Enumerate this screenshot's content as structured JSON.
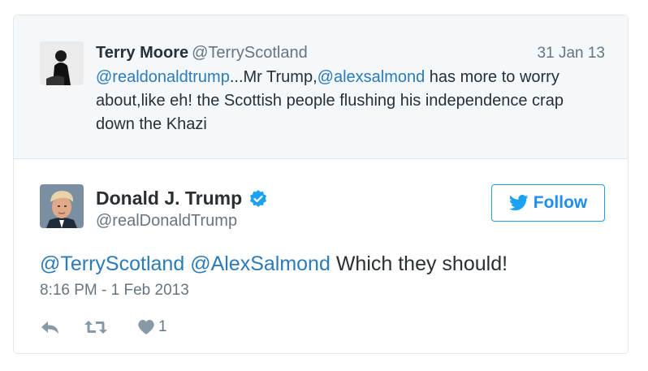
{
  "reply": {
    "name": "Terry Moore",
    "handle": "@TerryScotland",
    "date": "31 Jan 13",
    "mention1": "@realdonaldtrump",
    "text1": "...Mr Trump,",
    "mention2": "@alexsalmond",
    "text2": " has more to worry about,like eh! the Scottish people flushing his independence crap down the Khazi"
  },
  "tweet": {
    "name": "Donald J. Trump",
    "handle": "@realDonaldTrump",
    "mention1": "@TerryScotland",
    "mention2": "@AlexSalmond",
    "text": " Which they should!",
    "timestamp": "8:16 PM - 1 Feb 2013",
    "like_count": "1"
  },
  "follow_button": {
    "label": "Follow"
  },
  "colors": {
    "link": "#2b7bb9",
    "accent": "#1da1f2",
    "muted": "#66757f",
    "reply_bg": "#f5f8fa"
  },
  "icons": [
    "twitter-bird-icon",
    "verified-badge-icon",
    "reply-icon",
    "retweet-icon",
    "heart-icon"
  ]
}
